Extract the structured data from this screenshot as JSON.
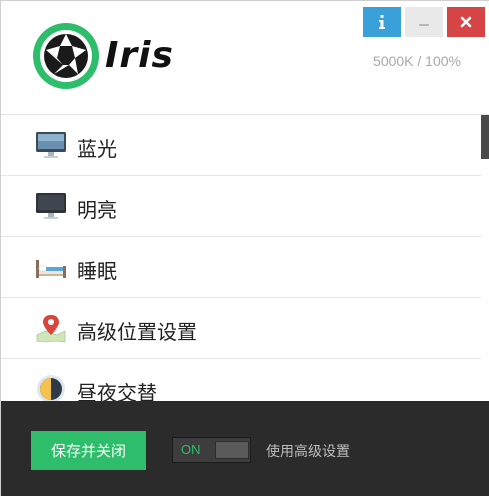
{
  "app": {
    "logo_text": "Iris",
    "status": "5000K / 100%"
  },
  "window_controls": {
    "info": "i",
    "minimize": "–",
    "close": "✖"
  },
  "menu": {
    "items": [
      {
        "label": "蓝光",
        "icon": "monitor-icon"
      },
      {
        "label": "明亮",
        "icon": "monitor-dark-icon"
      },
      {
        "label": "睡眠",
        "icon": "bed-icon"
      },
      {
        "label": "高级位置设置",
        "icon": "map-pin-icon"
      },
      {
        "label": "昼夜交替",
        "icon": "day-night-icon"
      }
    ]
  },
  "footer": {
    "save_label": "保存并关闭",
    "toggle_state": "ON",
    "advanced_label": "使用高级设置"
  },
  "colors": {
    "accent_green": "#2ebd6a",
    "info_blue": "#3aa0da",
    "close_red": "#d64545",
    "footer_bg": "#2b2b2b"
  }
}
